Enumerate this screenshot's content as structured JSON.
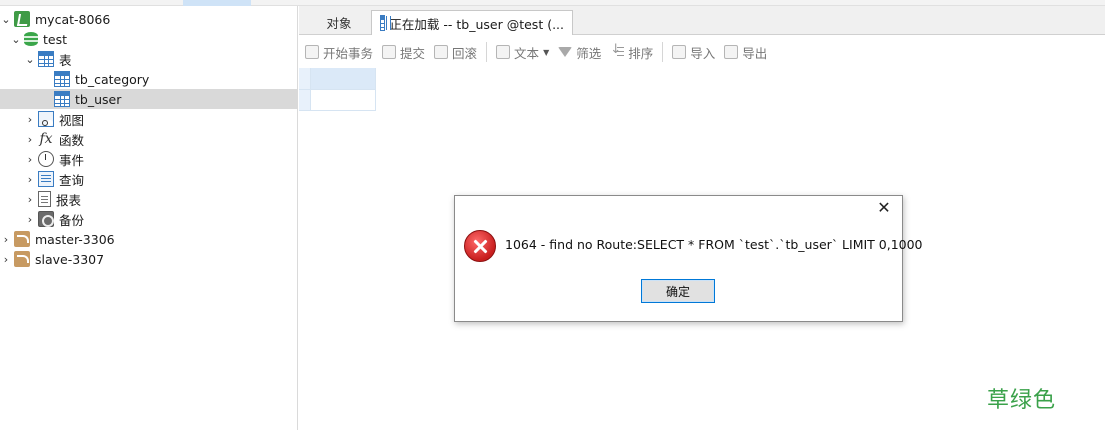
{
  "sidebar": {
    "items": [
      {
        "label": "mycat-8066",
        "icon": "mycat-connection-icon",
        "expanded": true
      },
      {
        "label": "test",
        "icon": "database-icon",
        "expanded": true
      },
      {
        "label": "表",
        "icon": "table-folder-icon",
        "expanded": true
      },
      {
        "label": "tb_category",
        "icon": "table-icon"
      },
      {
        "label": "tb_user",
        "icon": "table-icon",
        "selected": true
      },
      {
        "label": "视图",
        "icon": "view-icon",
        "expanded": false
      },
      {
        "label": "函数",
        "icon": "function-icon",
        "expanded": false
      },
      {
        "label": "事件",
        "icon": "event-icon",
        "expanded": false
      },
      {
        "label": "查询",
        "icon": "query-icon",
        "expanded": false
      },
      {
        "label": "报表",
        "icon": "report-icon",
        "expanded": false
      },
      {
        "label": "备份",
        "icon": "backup-icon",
        "expanded": false
      },
      {
        "label": "master-3306",
        "icon": "mysql-connection-icon",
        "expanded": false
      },
      {
        "label": "slave-3307",
        "icon": "mysql-connection-icon",
        "expanded": false
      }
    ]
  },
  "tabs": {
    "objects": "对象",
    "active": "正在加载 -- tb_user @test (..."
  },
  "toolbar": {
    "begin_transaction": "开始事务",
    "commit": "提交",
    "rollback": "回滚",
    "text": "文本",
    "filter": "筛选",
    "sort": "排序",
    "import": "导入",
    "export": "导出"
  },
  "dialog": {
    "message": "1064 -  find no Route:SELECT * FROM `test`.`tb_user` LIMIT 0,1000",
    "ok": "确定",
    "close": "✕"
  },
  "watermark": "草绿色",
  "colors": {
    "accent_blue": "#0078d7",
    "error_red": "#c81e1e",
    "watermark_green": "#3aa14a",
    "selection_gray": "#d9d9d9"
  }
}
